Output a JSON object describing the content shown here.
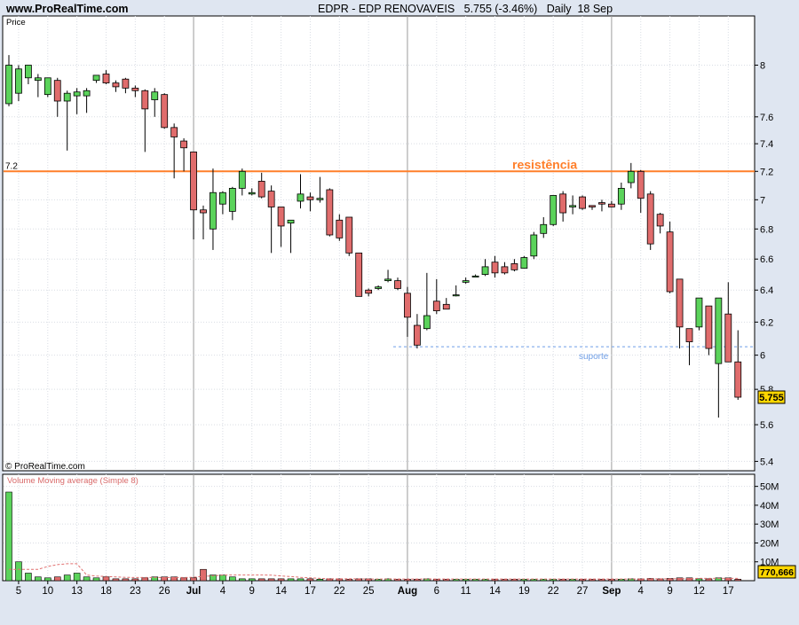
{
  "header": {
    "site": "www.ProRealTime.com",
    "title": "EDPR - EDP RENOVAVEIS   5.755 (-3.46%)   Daily  18 Sep"
  },
  "panel_labels": {
    "price": "Price",
    "copyright": "© ProRealTime.com",
    "volume": "Volume Moving average (Simple 8)"
  },
  "colors": {
    "up": "#5bd35b",
    "down": "#e06c6c",
    "resistance": "#ff7f2a",
    "support": "#6f9ee6",
    "last_price_badge": "#ffd700"
  },
  "chart_data": {
    "type": "candlestick",
    "y_scale": "log",
    "ylim": [
      5.35,
      8.4
    ],
    "yticks": [
      5.4,
      5.6,
      5.8,
      6,
      6.2,
      6.4,
      6.6,
      6.8,
      7,
      7.2,
      7.4,
      7.6,
      8
    ],
    "y_tick_labels": [
      "5.4",
      "5.6",
      "5.8",
      "6",
      "6.2",
      "6.4",
      "6.6",
      "6.8",
      "7",
      "7.2",
      "7.4",
      "7.6",
      "8"
    ],
    "x_tick_labels": [
      "5",
      "10",
      "13",
      "18",
      "23",
      "26",
      "Jul",
      "4",
      "9",
      "14",
      "17",
      "22",
      "25",
      "Aug",
      "6",
      "11",
      "14",
      "19",
      "22",
      "27",
      "Sep",
      "4",
      "9",
      "12",
      "17"
    ],
    "month_ticks": [
      "Jul",
      "Aug",
      "Sep"
    ],
    "candles": [
      {
        "o": 7.7,
        "h": 8.08,
        "l": 7.68,
        "c": 8.0
      },
      {
        "o": 7.78,
        "h": 8.0,
        "l": 7.72,
        "c": 7.97
      },
      {
        "o": 7.9,
        "h": 8.0,
        "l": 7.85,
        "c": 8.0
      },
      {
        "o": 7.88,
        "h": 7.93,
        "l": 7.75,
        "c": 7.9
      },
      {
        "o": 7.77,
        "h": 7.9,
        "l": 7.75,
        "c": 7.9
      },
      {
        "o": 7.88,
        "h": 7.9,
        "l": 7.6,
        "c": 7.72
      },
      {
        "o": 7.72,
        "h": 7.8,
        "l": 7.35,
        "c": 7.78
      },
      {
        "o": 7.76,
        "h": 7.82,
        "l": 7.62,
        "c": 7.79
      },
      {
        "o": 7.76,
        "h": 7.82,
        "l": 7.63,
        "c": 7.8
      },
      {
        "o": 7.88,
        "h": 7.9,
        "l": 7.86,
        "c": 7.92
      },
      {
        "o": 7.93,
        "h": 7.96,
        "l": 7.85,
        "c": 7.86
      },
      {
        "o": 7.86,
        "h": 7.88,
        "l": 7.79,
        "c": 7.83
      },
      {
        "o": 7.89,
        "h": 7.9,
        "l": 7.78,
        "c": 7.82
      },
      {
        "o": 7.82,
        "h": 7.84,
        "l": 7.75,
        "c": 7.8
      },
      {
        "o": 7.8,
        "h": 7.81,
        "l": 7.34,
        "c": 7.66
      },
      {
        "o": 7.73,
        "h": 7.82,
        "l": 7.6,
        "c": 7.79
      },
      {
        "o": 7.77,
        "h": 7.78,
        "l": 7.51,
        "c": 7.52
      },
      {
        "o": 7.52,
        "h": 7.55,
        "l": 7.15,
        "c": 7.45
      },
      {
        "o": 7.42,
        "h": 7.44,
        "l": 7.2,
        "c": 7.37
      },
      {
        "o": 7.34,
        "h": 7.34,
        "l": 6.73,
        "c": 6.93
      },
      {
        "o": 6.93,
        "h": 6.96,
        "l": 6.73,
        "c": 6.91
      },
      {
        "o": 6.8,
        "h": 7.22,
        "l": 6.66,
        "c": 7.05
      },
      {
        "o": 6.97,
        "h": 7.06,
        "l": 6.9,
        "c": 7.05
      },
      {
        "o": 6.92,
        "h": 7.09,
        "l": 6.86,
        "c": 7.08
      },
      {
        "o": 7.08,
        "h": 7.22,
        "l": 7.03,
        "c": 7.2
      },
      {
        "o": 7.04,
        "h": 7.08,
        "l": 7.03,
        "c": 7.05
      },
      {
        "o": 7.13,
        "h": 7.19,
        "l": 7.01,
        "c": 7.02
      },
      {
        "o": 7.06,
        "h": 7.1,
        "l": 6.64,
        "c": 6.95
      },
      {
        "o": 6.95,
        "h": 6.95,
        "l": 6.68,
        "c": 6.82
      },
      {
        "o": 6.84,
        "h": 6.86,
        "l": 6.64,
        "c": 6.86
      },
      {
        "o": 6.99,
        "h": 7.18,
        "l": 6.94,
        "c": 7.04
      },
      {
        "o": 7.02,
        "h": 7.05,
        "l": 6.92,
        "c": 7.0
      },
      {
        "o": 7.0,
        "h": 7.16,
        "l": 6.98,
        "c": 7.01
      },
      {
        "o": 7.07,
        "h": 7.08,
        "l": 6.75,
        "c": 6.76
      },
      {
        "o": 6.86,
        "h": 6.9,
        "l": 6.72,
        "c": 6.74
      },
      {
        "o": 6.88,
        "h": 6.88,
        "l": 6.62,
        "c": 6.64
      },
      {
        "o": 6.64,
        "h": 6.64,
        "l": 6.36,
        "c": 6.36
      },
      {
        "o": 6.4,
        "h": 6.41,
        "l": 6.36,
        "c": 6.38
      },
      {
        "o": 6.41,
        "h": 6.43,
        "l": 6.4,
        "c": 6.42
      },
      {
        "o": 6.46,
        "h": 6.53,
        "l": 6.45,
        "c": 6.47
      },
      {
        "o": 6.46,
        "h": 6.48,
        "l": 6.4,
        "c": 6.41
      },
      {
        "o": 6.38,
        "h": 6.42,
        "l": 6.11,
        "c": 6.23
      },
      {
        "o": 6.18,
        "h": 6.25,
        "l": 6.04,
        "c": 6.06
      },
      {
        "o": 6.16,
        "h": 6.51,
        "l": 6.15,
        "c": 6.24
      },
      {
        "o": 6.33,
        "h": 6.47,
        "l": 6.25,
        "c": 6.27
      },
      {
        "o": 6.31,
        "h": 6.35,
        "l": 6.28,
        "c": 6.28
      },
      {
        "o": 6.37,
        "h": 6.43,
        "l": 6.36,
        "c": 6.37
      },
      {
        "o": 6.45,
        "h": 6.48,
        "l": 6.44,
        "c": 6.46
      },
      {
        "o": 6.49,
        "h": 6.5,
        "l": 6.49,
        "c": 6.49
      },
      {
        "o": 6.5,
        "h": 6.6,
        "l": 6.49,
        "c": 6.55
      },
      {
        "o": 6.58,
        "h": 6.62,
        "l": 6.48,
        "c": 6.51
      },
      {
        "o": 6.55,
        "h": 6.58,
        "l": 6.5,
        "c": 6.51
      },
      {
        "o": 6.57,
        "h": 6.6,
        "l": 6.52,
        "c": 6.53
      },
      {
        "o": 6.54,
        "h": 6.62,
        "l": 6.54,
        "c": 6.61
      },
      {
        "o": 6.62,
        "h": 6.78,
        "l": 6.6,
        "c": 6.76
      },
      {
        "o": 6.77,
        "h": 6.88,
        "l": 6.74,
        "c": 6.83
      },
      {
        "o": 6.83,
        "h": 7.03,
        "l": 6.82,
        "c": 7.03
      },
      {
        "o": 7.04,
        "h": 7.06,
        "l": 6.85,
        "c": 6.91
      },
      {
        "o": 6.95,
        "h": 7.03,
        "l": 6.9,
        "c": 6.96
      },
      {
        "o": 7.02,
        "h": 7.03,
        "l": 6.93,
        "c": 6.94
      },
      {
        "o": 6.96,
        "h": 6.96,
        "l": 6.93,
        "c": 6.95
      },
      {
        "o": 6.98,
        "h": 7.0,
        "l": 6.92,
        "c": 6.97
      },
      {
        "o": 6.97,
        "h": 6.99,
        "l": 6.96,
        "c": 6.95
      },
      {
        "o": 6.97,
        "h": 7.12,
        "l": 6.93,
        "c": 7.08
      },
      {
        "o": 7.12,
        "h": 7.26,
        "l": 7.08,
        "c": 7.2
      },
      {
        "o": 7.2,
        "h": 7.21,
        "l": 6.91,
        "c": 7.01
      },
      {
        "o": 7.04,
        "h": 7.06,
        "l": 6.66,
        "c": 6.7
      },
      {
        "o": 6.9,
        "h": 6.91,
        "l": 6.77,
        "c": 6.82
      },
      {
        "o": 6.78,
        "h": 6.85,
        "l": 6.38,
        "c": 6.39
      },
      {
        "o": 6.47,
        "h": 6.47,
        "l": 6.04,
        "c": 6.17
      },
      {
        "o": 6.16,
        "h": 6.16,
        "l": 5.94,
        "c": 6.08
      },
      {
        "o": 6.17,
        "h": 6.35,
        "l": 6.15,
        "c": 6.35
      },
      {
        "o": 6.3,
        "h": 6.3,
        "l": 6.0,
        "c": 6.04
      },
      {
        "o": 5.95,
        "h": 6.35,
        "l": 5.64,
        "c": 6.35
      },
      {
        "o": 6.25,
        "h": 6.45,
        "l": 5.96,
        "c": 5.96
      },
      {
        "o": 5.96,
        "h": 6.15,
        "l": 5.74,
        "c": 5.755
      }
    ],
    "volume": {
      "ylim": [
        0,
        55
      ],
      "yticks": [
        10,
        20,
        30,
        40,
        50
      ],
      "y_tick_labels": [
        "10M",
        "20M",
        "30M",
        "40M",
        "50M"
      ],
      "last_value_label": "770,666",
      "values": [
        47,
        10,
        4,
        2,
        1.5,
        2,
        3,
        4,
        2,
        1.5,
        2,
        1,
        1,
        1,
        1.5,
        2,
        2,
        2,
        1.5,
        1.5,
        6,
        3,
        3,
        2,
        1,
        1,
        1,
        1,
        1,
        1,
        1,
        1,
        0.8,
        1,
        1,
        0.8,
        1,
        1,
        0.8,
        1,
        0.8,
        0.8,
        0.8,
        1,
        0.8,
        0.8,
        0.8,
        0.8,
        0.8,
        0.8,
        0.8,
        0.8,
        0.8,
        0.8,
        0.8,
        0.8,
        0.8,
        0.8,
        0.8,
        0.8,
        0.8,
        0.8,
        0.8,
        0.8,
        1,
        1,
        1.2,
        1,
        1.2,
        1.5,
        1.5,
        1,
        1,
        1.5,
        1.5,
        0.8
      ],
      "moving_average": [
        6,
        6,
        6,
        6,
        7.5,
        8.5,
        9,
        9,
        3,
        2.5,
        2.2,
        2,
        1.8,
        1.7,
        1.7,
        1.7,
        1.7,
        1.7,
        1.7,
        1.8,
        2.3,
        2.6,
        2.9,
        3,
        3,
        3,
        3,
        2.9,
        2.5,
        2.2,
        1.8,
        1.5,
        1.2,
        1,
        1,
        1,
        1,
        0.9,
        0.9,
        0.9,
        0.9,
        0.9,
        0.9,
        0.9,
        0.9,
        0.9,
        0.9,
        0.9,
        0.9,
        0.9,
        0.9,
        0.9,
        0.9,
        0.9,
        0.9,
        0.9,
        0.9,
        0.9,
        0.9,
        0.9,
        0.9,
        0.9,
        0.9,
        0.9,
        0.9,
        0.9,
        1,
        1,
        1,
        1.1,
        1.1,
        1.2,
        1.2,
        1.2,
        1.2,
        1.2
      ]
    },
    "annotations": [
      {
        "text": "resistência",
        "price": 7.2
      },
      {
        "text": "suporte",
        "price": 6.05
      }
    ],
    "resistance_price_label": "7.2",
    "last_price_label": "5.755"
  }
}
